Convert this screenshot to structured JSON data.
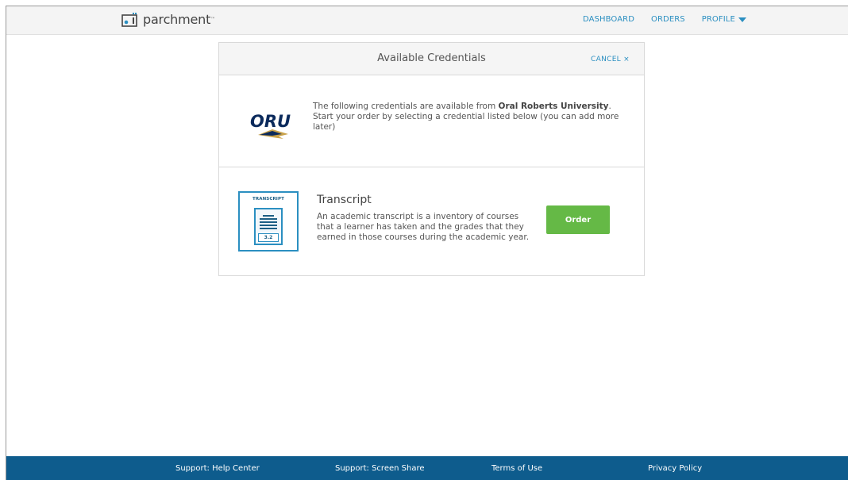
{
  "header": {
    "logo_text": "parchment",
    "nav": {
      "dashboard": "DASHBOARD",
      "orders": "ORDERS",
      "profile": "PROFILE"
    }
  },
  "card": {
    "title": "Available Credentials",
    "cancel_label": "CANCEL ×",
    "school": {
      "logo_text": "ORU",
      "intro_prefix": "The following credentials are available from ",
      "name": "Oral Roberts University",
      "intro_suffix": ". Start your order by selecting a credential listed below (you can add more later)"
    },
    "credential": {
      "icon_label": "TRANSCRIPT",
      "icon_grade": "3.2",
      "title": "Transcript",
      "description": "An academic transcript is a inventory of courses that a learner has taken and the grades that they earned in those courses during the academic year.",
      "order_label": "Order"
    }
  },
  "footer": {
    "links": [
      "Support: Help Center",
      "Support: Screen Share",
      "Terms of Use",
      "Privacy Policy"
    ]
  },
  "colors": {
    "accent": "#2b8fc1",
    "order_button": "#65b946",
    "footer": "#0e5c8d"
  }
}
